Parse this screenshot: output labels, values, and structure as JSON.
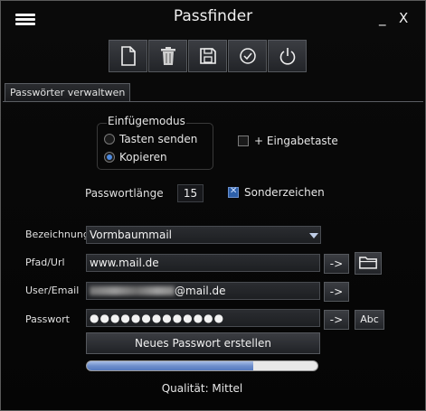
{
  "window": {
    "title": "Passfinder",
    "minimize_label": "_",
    "close_label": "X"
  },
  "toolbar": {
    "buttons": [
      {
        "name": "new",
        "icon": "new-document-icon"
      },
      {
        "name": "delete",
        "icon": "trash-icon"
      },
      {
        "name": "save",
        "icon": "save-icon"
      },
      {
        "name": "confirm",
        "icon": "check-circle-icon"
      },
      {
        "name": "power",
        "icon": "power-icon"
      }
    ]
  },
  "tabs": [
    {
      "label": "Passwörter verwaltwen",
      "active": true
    }
  ],
  "insert_mode": {
    "label": "Einfügemodus",
    "options": [
      {
        "label": "Tasten senden",
        "selected": false
      },
      {
        "label": "Kopieren",
        "selected": true
      }
    ]
  },
  "enter_key": {
    "label": "+ Eingabetaste",
    "checked": false
  },
  "password_length": {
    "label": "Passwortlänge",
    "value": "15"
  },
  "special_chars": {
    "label": "Sonderzeichen",
    "checked": true
  },
  "fields": {
    "name": {
      "label": "Bezeichnung",
      "value": "Vormbaummail"
    },
    "url": {
      "label": "Pfad/Url",
      "value": "www.mail.de"
    },
    "user": {
      "label": "User/Email",
      "value_suffix": "@mail.de"
    },
    "password": {
      "label": "Passwort",
      "value": "●●●●●●●●●●●●●"
    }
  },
  "buttons": {
    "arrow": "->",
    "abc": "Abc",
    "generate": "Neues Passwort erstellen"
  },
  "quality": {
    "label": "Qualität: Mittel",
    "progress": 0.72
  },
  "colors": {
    "background": "#050505",
    "accent": "#5679bd",
    "checkbox_on": "#2d5fa8"
  }
}
